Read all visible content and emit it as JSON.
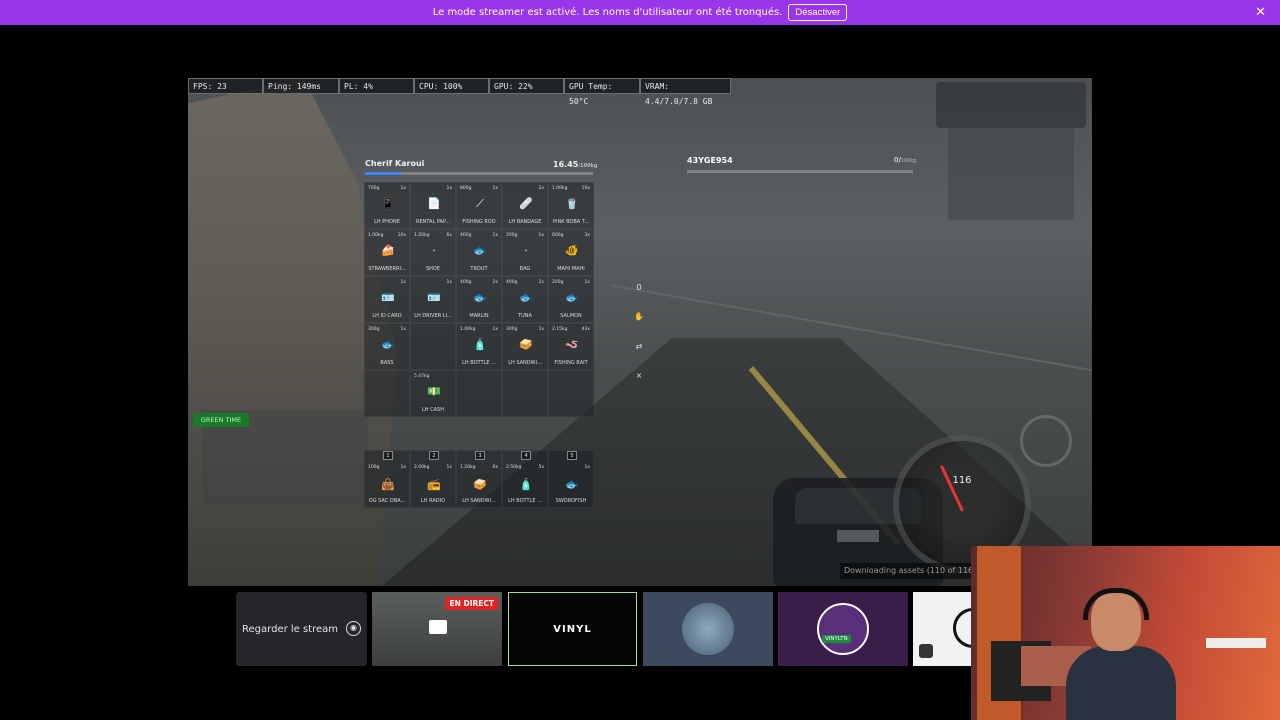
{
  "banner": {
    "message": "Le mode streamer est activé. Les noms d'utilisateur ont été tronqués.",
    "button": "Désactiver"
  },
  "stats": [
    "FPS: 23",
    "Ping: 149ms",
    "PL: 4%",
    "CPU: 100%",
    "GPU: 22%",
    "GPU Temp: 50°C",
    "VRAM: 4.4/7.0/7.8 GB"
  ],
  "inventory": {
    "player": "Cherif Karoui",
    "weight": "16.45",
    "weight_max": "/100kg",
    "weight_fraction": 0.16,
    "slots": [
      {
        "w": "700g",
        "q": "1x",
        "label": "LH PHONE",
        "icon": "📱"
      },
      {
        "w": "",
        "q": "1x",
        "label": "RENTAL PAP...",
        "icon": "📄"
      },
      {
        "w": "800g",
        "q": "1x",
        "label": "FISHING ROD",
        "icon": "⟋"
      },
      {
        "w": "",
        "q": "2x",
        "label": "LH BANDAGE",
        "icon": "🩹"
      },
      {
        "w": "1.00kg",
        "q": "10x",
        "label": "PINK BOBA T...",
        "icon": "🥤"
      },
      {
        "w": "1.00kg",
        "q": "10x",
        "label": "STRAWBERRI...",
        "icon": "🍰"
      },
      {
        "w": "1.20kg",
        "q": "6x",
        "label": "SHOE",
        "icon": "·"
      },
      {
        "w": "400g",
        "q": "1x",
        "label": "TROUT",
        "icon": "🐟"
      },
      {
        "w": "200g",
        "q": "1x",
        "label": "BAG",
        "icon": "·"
      },
      {
        "w": "600g",
        "q": "3x",
        "label": "MAHI MAHI",
        "icon": "🐠"
      },
      {
        "w": "",
        "q": "1x",
        "label": "LH ID CARD",
        "icon": "🪪"
      },
      {
        "w": "",
        "q": "1x",
        "label": "LH DRIVER LI...",
        "icon": "🪪"
      },
      {
        "w": "400g",
        "q": "2x",
        "label": "MARLIN",
        "icon": "🐟"
      },
      {
        "w": "400g",
        "q": "2x",
        "label": "TUNA",
        "icon": "🐟"
      },
      {
        "w": "200g",
        "q": "1x",
        "label": "SALMON",
        "icon": "🐟"
      },
      {
        "w": "300g",
        "q": "1x",
        "label": "BASS",
        "icon": "🐟"
      },
      {
        "w": "",
        "q": "",
        "label": "",
        "icon": ""
      },
      {
        "w": "1.00kg",
        "q": "1x",
        "label": "LH BOTTLE ...",
        "icon": "🧴"
      },
      {
        "w": "300g",
        "q": "1x",
        "label": "LH SANDWI...",
        "icon": "🥪"
      },
      {
        "w": "2.15kg",
        "q": "43x",
        "label": "FISHING BAIT",
        "icon": "🪱"
      },
      {
        "w": "",
        "q": "",
        "label": "",
        "icon": ""
      },
      {
        "w": "5.47kg",
        "q": "",
        "label": "LH CASH",
        "icon": "💵"
      },
      {
        "w": "",
        "q": "",
        "label": "",
        "icon": ""
      },
      {
        "w": "",
        "q": "",
        "label": "",
        "icon": ""
      },
      {
        "w": "",
        "q": "",
        "label": "",
        "icon": ""
      }
    ],
    "hotbar": [
      {
        "n": "1",
        "w": "100g",
        "q": "1x",
        "label": "OG SAC DBA...",
        "icon": "👜"
      },
      {
        "n": "2",
        "w": "2.00kg",
        "q": "1x",
        "label": "LH RADIO",
        "icon": "📻"
      },
      {
        "n": "3",
        "w": "1.20kg",
        "q": "6x",
        "label": "LH SANDWI...",
        "icon": "🥪"
      },
      {
        "n": "4",
        "w": "2.50kg",
        "q": "5x",
        "label": "LH BOTTLE ...",
        "icon": "🧴"
      },
      {
        "n": "5",
        "w": "",
        "q": "1x",
        "label": "SWORDFISH",
        "icon": "🐟"
      }
    ],
    "controls": [
      "0",
      "✋",
      "⇄",
      "×"
    ]
  },
  "vehicle": {
    "plate": "43YGE954",
    "weight": "0/",
    "weight_max": "100kg"
  },
  "hud": {
    "green_tag": "GREEN TIME",
    "speed": "116",
    "download": "Downloading assets (110 of 116)"
  },
  "bottom": {
    "watch_label": "Regarder le stream",
    "live_badge": "EN DIRECT",
    "vinyl_label": "VINYL",
    "vinyl_tag": "VINYLTN"
  }
}
